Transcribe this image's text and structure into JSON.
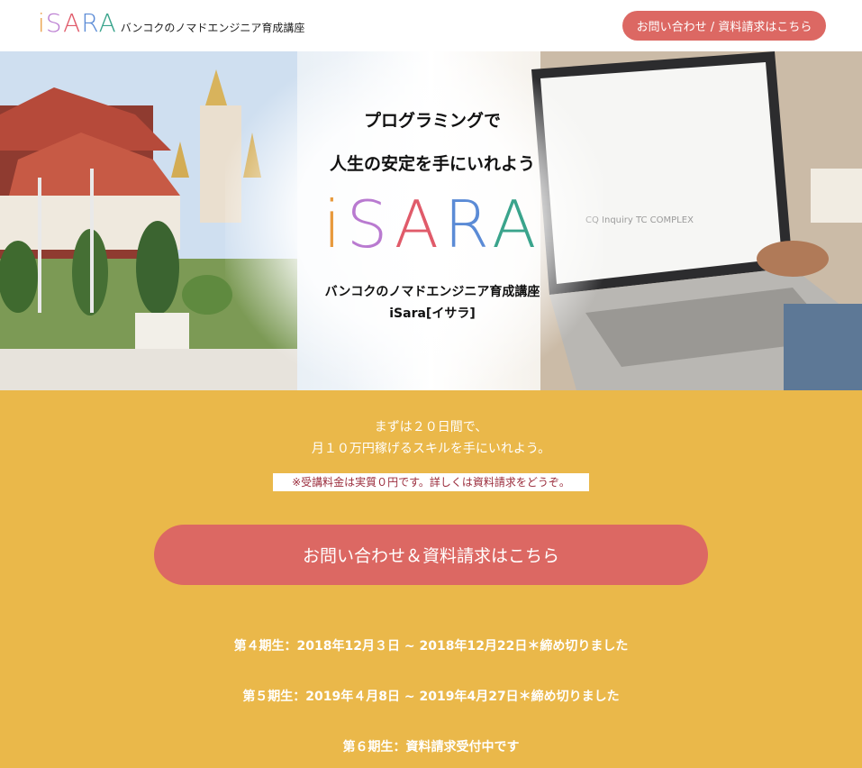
{
  "header": {
    "logo_letters": [
      "i",
      "S",
      "A",
      "R",
      "A"
    ],
    "tagline": "バンコクのノマドエンジニア育成講座",
    "contact_button": "お問い合わせ / 資料請求はこちら"
  },
  "hero": {
    "headline_line1": "プログラミングで",
    "headline_line2": "人生の安定を手にいれよう",
    "logo_letters": [
      "i",
      "S",
      "A",
      "R",
      "A"
    ],
    "subtitle_line1": "バンコクのノマドエンジニア育成講座",
    "subtitle_line2": "iSara[イサラ]"
  },
  "main": {
    "lead_line1": "まずは２０日間で、",
    "lead_line2": "月１０万円稼げるスキルを手にいれよう。",
    "note": "※受講料金は実質０円です。詳しくは資料請求をどうぞ。",
    "cta_button": "お問い合わせ＆資料請求はこちら",
    "terms": [
      "第４期生：2018年12月３日 ~ 2018年12月22日＊締め切りました",
      "第５期生：2019年４月8日 ~ 2019年4月27日＊締め切りました",
      "第６期生：資料請求受付中です"
    ]
  },
  "colors": {
    "accent_button": "#dc6863",
    "main_background": "#eab84a",
    "note_text": "#9b2c3c"
  }
}
